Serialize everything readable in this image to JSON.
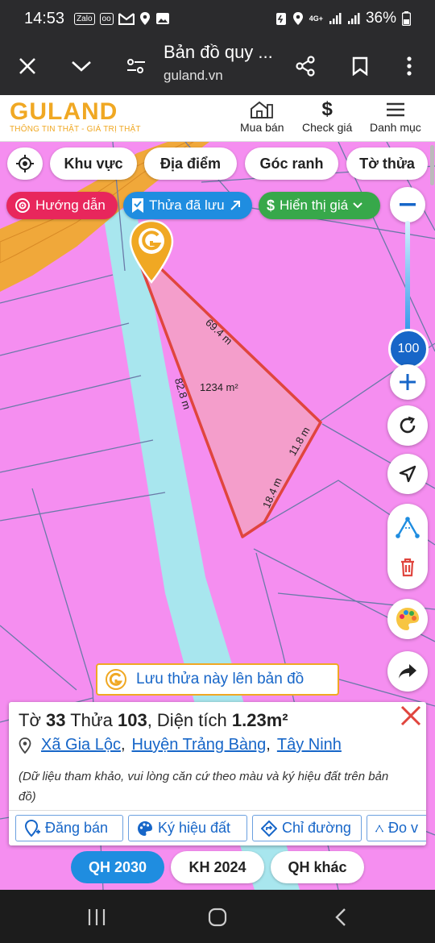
{
  "status": {
    "time": "14:53",
    "left_icons": [
      "zalo-icon",
      "voicemail-icon",
      "gmail-icon",
      "location-icon",
      "gallery-icon"
    ],
    "zalo_label": "Zalo",
    "network": "4G+",
    "battery": "36%"
  },
  "browser": {
    "title": "Bản đồ quy ...",
    "url": "guland.vn"
  },
  "site": {
    "logo": "GULAND",
    "tagline": "THÔNG TIN THẬT - GIÁ TRỊ THẬT",
    "nav": [
      {
        "label": "Mua bán",
        "icon": "house-icon"
      },
      {
        "label": "Check giá",
        "icon": "dollar-icon"
      },
      {
        "label": "Danh mục",
        "icon": "menu-icon"
      }
    ]
  },
  "filters": {
    "chips": [
      "Khu vực",
      "Địa điểm",
      "Góc ranh",
      "Tờ thửa"
    ],
    "guide": "Hướng dẫn",
    "saved": "Thửa đã lưu",
    "price": "Hiển thị giá"
  },
  "map": {
    "zoom": "100",
    "parcel_area": "1234 m²",
    "edges": [
      "69.4 m",
      "82.8 m",
      "11.8 m",
      "18.4 m"
    ],
    "colors": {
      "residential_pink": "#f58ef0",
      "road_blue": "#a8e6ee",
      "main_road_orange": "#f0a83a",
      "parcel_red": "#e0453e",
      "accent_blue": "#1766c8"
    }
  },
  "save_banner": "Lưu thửa này lên bản đồ",
  "info": {
    "sheet_label": "Tờ",
    "sheet_no": "33",
    "parcel_label": "Thửa",
    "parcel_no": "103",
    "area_label": "Diện tích",
    "area_value": "1.23m²",
    "commune": "Xã Gia Lộc",
    "district": "Huyện Trảng Bàng",
    "province": "Tây Ninh",
    "note": "(Dữ liệu tham khảo, vui lòng căn cứ theo màu và ký hiệu đất trên bản đồ)",
    "actions": [
      "Đăng bán",
      "Ký hiệu đất",
      "Chỉ đường",
      "Đo v"
    ]
  },
  "tabs": [
    {
      "label": "QH 2030",
      "active": true
    },
    {
      "label": "KH 2024",
      "active": false
    },
    {
      "label": "QH khác",
      "active": false
    }
  ]
}
